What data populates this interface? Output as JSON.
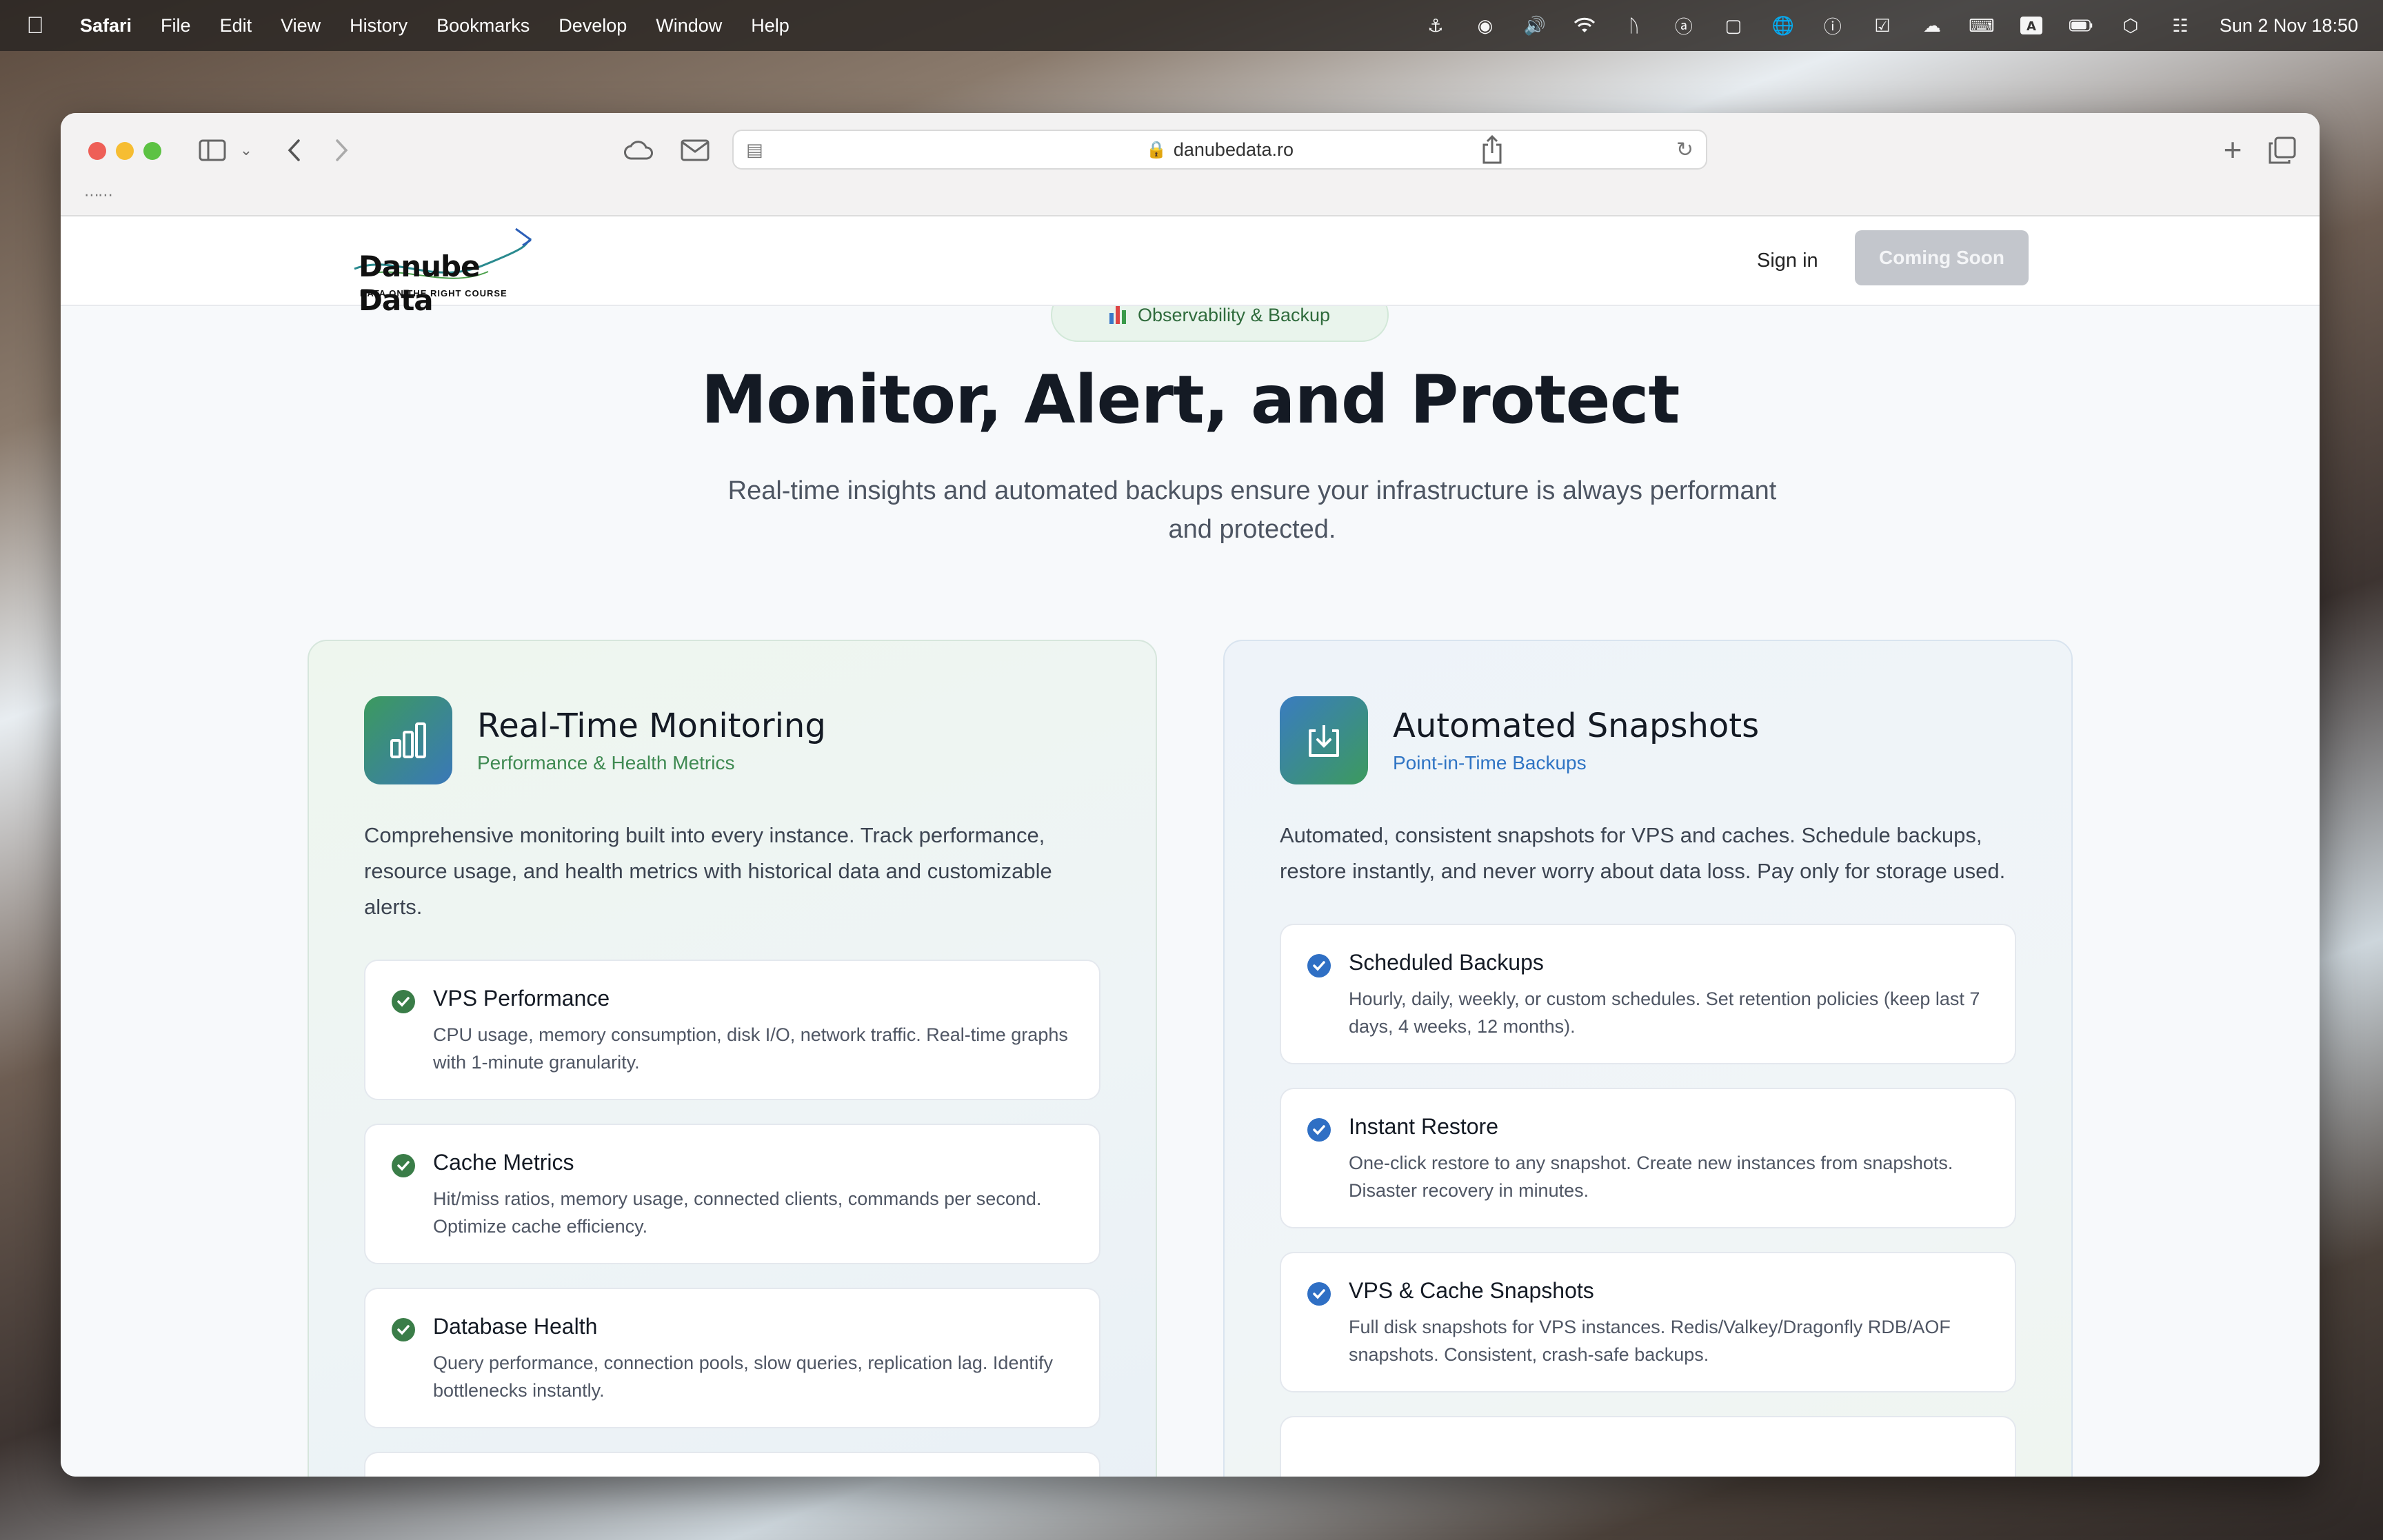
{
  "menubar": {
    "app": "Safari",
    "items": [
      "File",
      "Edit",
      "View",
      "History",
      "Bookmarks",
      "Develop",
      "Window",
      "Help"
    ],
    "clock": "Sun 2 Nov  18:50"
  },
  "browser": {
    "url": "danubedata.ro"
  },
  "site": {
    "logo_text": "Danube Data",
    "logo_tagline": "DATA ON THE RIGHT COURSE",
    "signin_label": "Sign in",
    "cta_label": "Coming Soon"
  },
  "hero": {
    "badge": "Observability & Backup",
    "title": "Monitor, Alert, and Protect",
    "subtitle": "Real-time insights and automated backups ensure your infrastructure is always performant and protected."
  },
  "cards": [
    {
      "title": "Real-Time Monitoring",
      "subtitle": "Performance & Health Metrics",
      "icon": "bar-chart-icon",
      "description": "Comprehensive monitoring built into every instance. Track performance, resource usage, and health metrics with historical data and customizable alerts.",
      "features": [
        {
          "title": "VPS Performance",
          "description": "CPU usage, memory consumption, disk I/O, network traffic. Real-time graphs with 1-minute granularity."
        },
        {
          "title": "Cache Metrics",
          "description": "Hit/miss ratios, memory usage, connected clients, commands per second. Optimize cache efficiency."
        },
        {
          "title": "Database Health",
          "description": "Query performance, connection pools, slow queries, replication lag. Identify bottlenecks instantly."
        }
      ]
    },
    {
      "title": "Automated Snapshots",
      "subtitle": "Point-in-Time Backups",
      "icon": "download-tray-icon",
      "description": "Automated, consistent snapshots for VPS and caches. Schedule backups, restore instantly, and never worry about data loss. Pay only for storage used.",
      "features": [
        {
          "title": "Scheduled Backups",
          "description": "Hourly, daily, weekly, or custom schedules. Set retention policies (keep last 7 days, 4 weeks, 12 months)."
        },
        {
          "title": "Instant Restore",
          "description": "One-click restore to any snapshot. Create new instances from snapshots. Disaster recovery in minutes."
        },
        {
          "title": "VPS & Cache Snapshots",
          "description": "Full disk snapshots for VPS instances. Redis/Valkey/Dragonfly RDB/AOF snapshots. Consistent, crash-safe backups."
        }
      ]
    }
  ],
  "colors": {
    "green_accent": "#3f8a52",
    "blue_accent": "#2f74c4",
    "cta_disabled": "#c3c6cc"
  }
}
